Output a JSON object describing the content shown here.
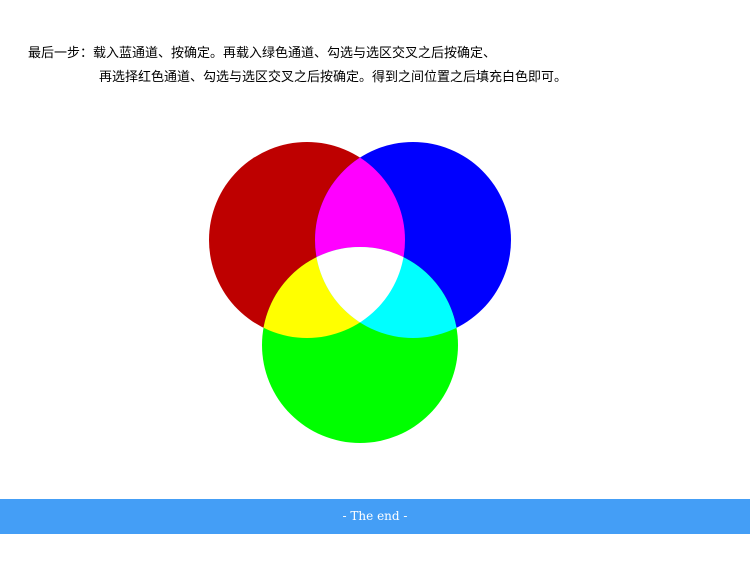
{
  "instructions": {
    "line1": "最后一步：载入蓝通道、按确定。再载入绿色通道、勾选与选区交叉之后按确定、",
    "line2": "再选择红色通道、勾选与选区交叉之后按确定。得到之间位置之后填充白色即可。"
  },
  "diagram": {
    "colors": {
      "red": "#be0000",
      "blue": "#0000ff",
      "green": "#00ff00",
      "red_blue": "#ff00ff",
      "red_green": "#ffff00",
      "blue_green": "#00ffff",
      "all": "#ffffff"
    }
  },
  "footer": {
    "text": "- The end -",
    "color": "#449ef6"
  }
}
